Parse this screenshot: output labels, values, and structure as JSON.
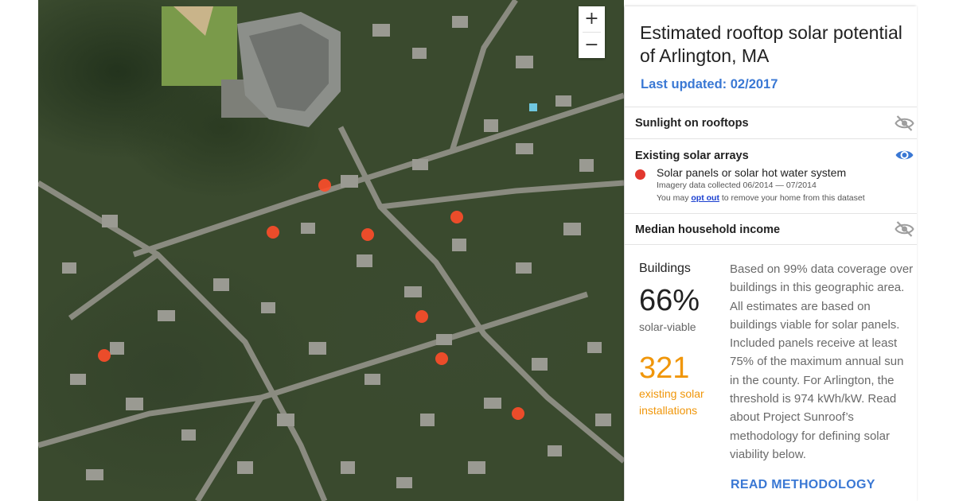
{
  "zoom": {
    "in_label": "+",
    "out_label": "−"
  },
  "panel": {
    "title": "Estimated rooftop solar potential of Arlington, MA",
    "last_updated": "Last updated: 02/2017",
    "layers": {
      "sunlight": {
        "label": "Sunlight on rooftops",
        "icon": "eye-off-icon",
        "visible": false
      },
      "solar_arrays": {
        "label": "Existing solar arrays",
        "icon": "eye-icon",
        "visible": true,
        "legend_label": "Solar panels or solar hot water system",
        "legend_color": "#e2382f",
        "imagery_note": "Imagery data collected 06/2014 — 07/2014",
        "optout_prefix": "You may ",
        "optout_link": "opt out",
        "optout_suffix": " to remove your home from this dataset"
      },
      "income": {
        "label": "Median household income",
        "icon": "eye-off-icon",
        "visible": false
      }
    },
    "stats": {
      "buildings_label": "Buildings",
      "viable_percent": "66%",
      "viable_label": "solar-viable",
      "installations_count": "321",
      "installations_label": "existing solar installations",
      "installations_color": "#f0960a"
    },
    "description": "Based on 99% data coverage over buildings in this geographic area. All estimates are based on buildings viable for solar panels. Included panels receive at least 75% of the maximum annual sun in the county. For Arlington, the threshold is 974 kWh/kW. Read about Project Sunroof’s methodology for defining solar viability below.",
    "cta": "READ METHODOLOGY"
  },
  "colors": {
    "accent": "#3a78d4",
    "marker": "#e2382f"
  }
}
